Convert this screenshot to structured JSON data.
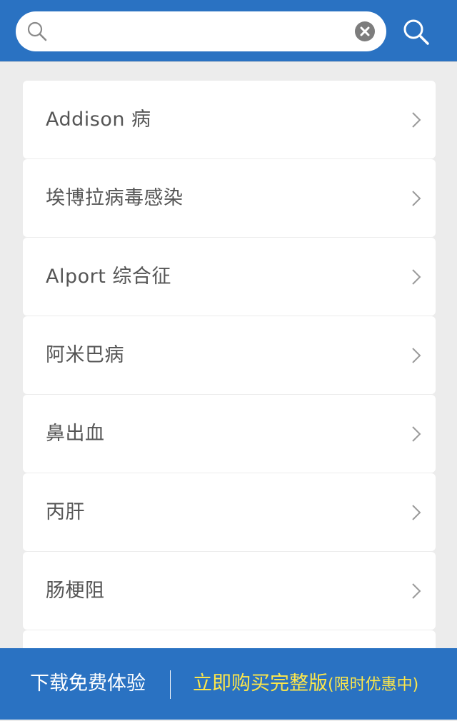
{
  "search": {
    "value": "",
    "placeholder": ""
  },
  "results": [
    {
      "label": "Addison 病"
    },
    {
      "label": "埃博拉病毒感染"
    },
    {
      "label": "Alport 综合征"
    },
    {
      "label": "阿米巴病"
    },
    {
      "label": "鼻出血"
    },
    {
      "label": "丙肝"
    },
    {
      "label": "肠梗阻"
    },
    {
      "label": ""
    }
  ],
  "footer": {
    "trial_label": "下载免费体验",
    "buy_label": "立即购买完整版",
    "buy_note": "(限时优惠中)"
  },
  "colors": {
    "header_bg": "#2a72c2",
    "buy_text": "#fde74a"
  },
  "icons": [
    "search-icon",
    "clear-icon",
    "chevron-right-icon"
  ]
}
